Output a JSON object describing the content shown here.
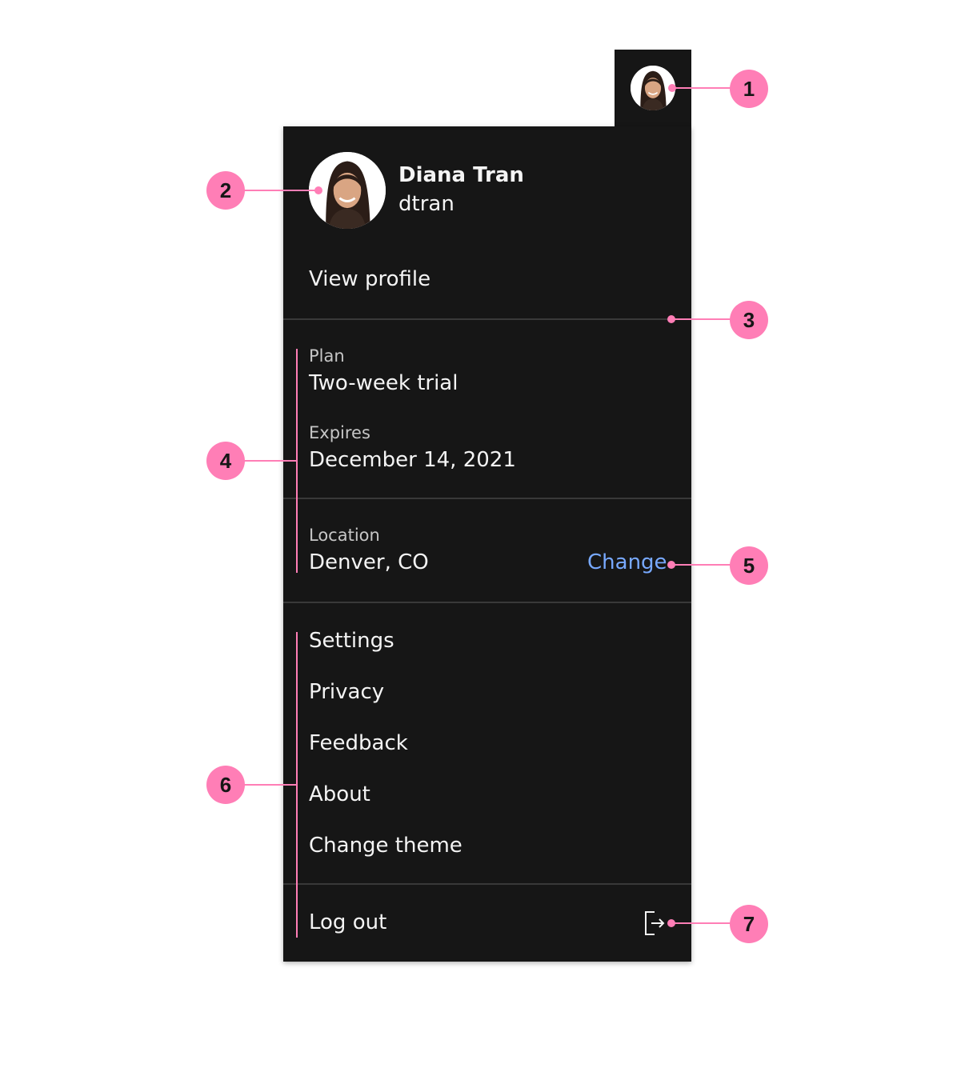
{
  "profile": {
    "name": "Diana Tran",
    "username": "dtran",
    "view_profile_label": "View profile"
  },
  "account": {
    "plan_label": "Plan",
    "plan_value": "Two-week trial",
    "expires_label": "Expires",
    "expires_value": "December 14, 2021"
  },
  "location": {
    "label": "Location",
    "value": "Denver, CO",
    "change_label": "Change"
  },
  "menu": {
    "items": [
      {
        "label": "Settings"
      },
      {
        "label": "Privacy"
      },
      {
        "label": "Feedback"
      },
      {
        "label": "About"
      },
      {
        "label": "Change theme"
      }
    ]
  },
  "logout": {
    "label": "Log out",
    "icon": "logout-icon"
  },
  "annotations": {
    "badges": [
      "1",
      "2",
      "3",
      "4",
      "5",
      "6",
      "7"
    ]
  },
  "colors": {
    "panel_background": "#161616",
    "divider": "#393939",
    "text_primary": "#f4f4f4",
    "text_secondary": "#c6c6c6",
    "link": "#78a9ff",
    "annotation": "#ff7eb6"
  }
}
